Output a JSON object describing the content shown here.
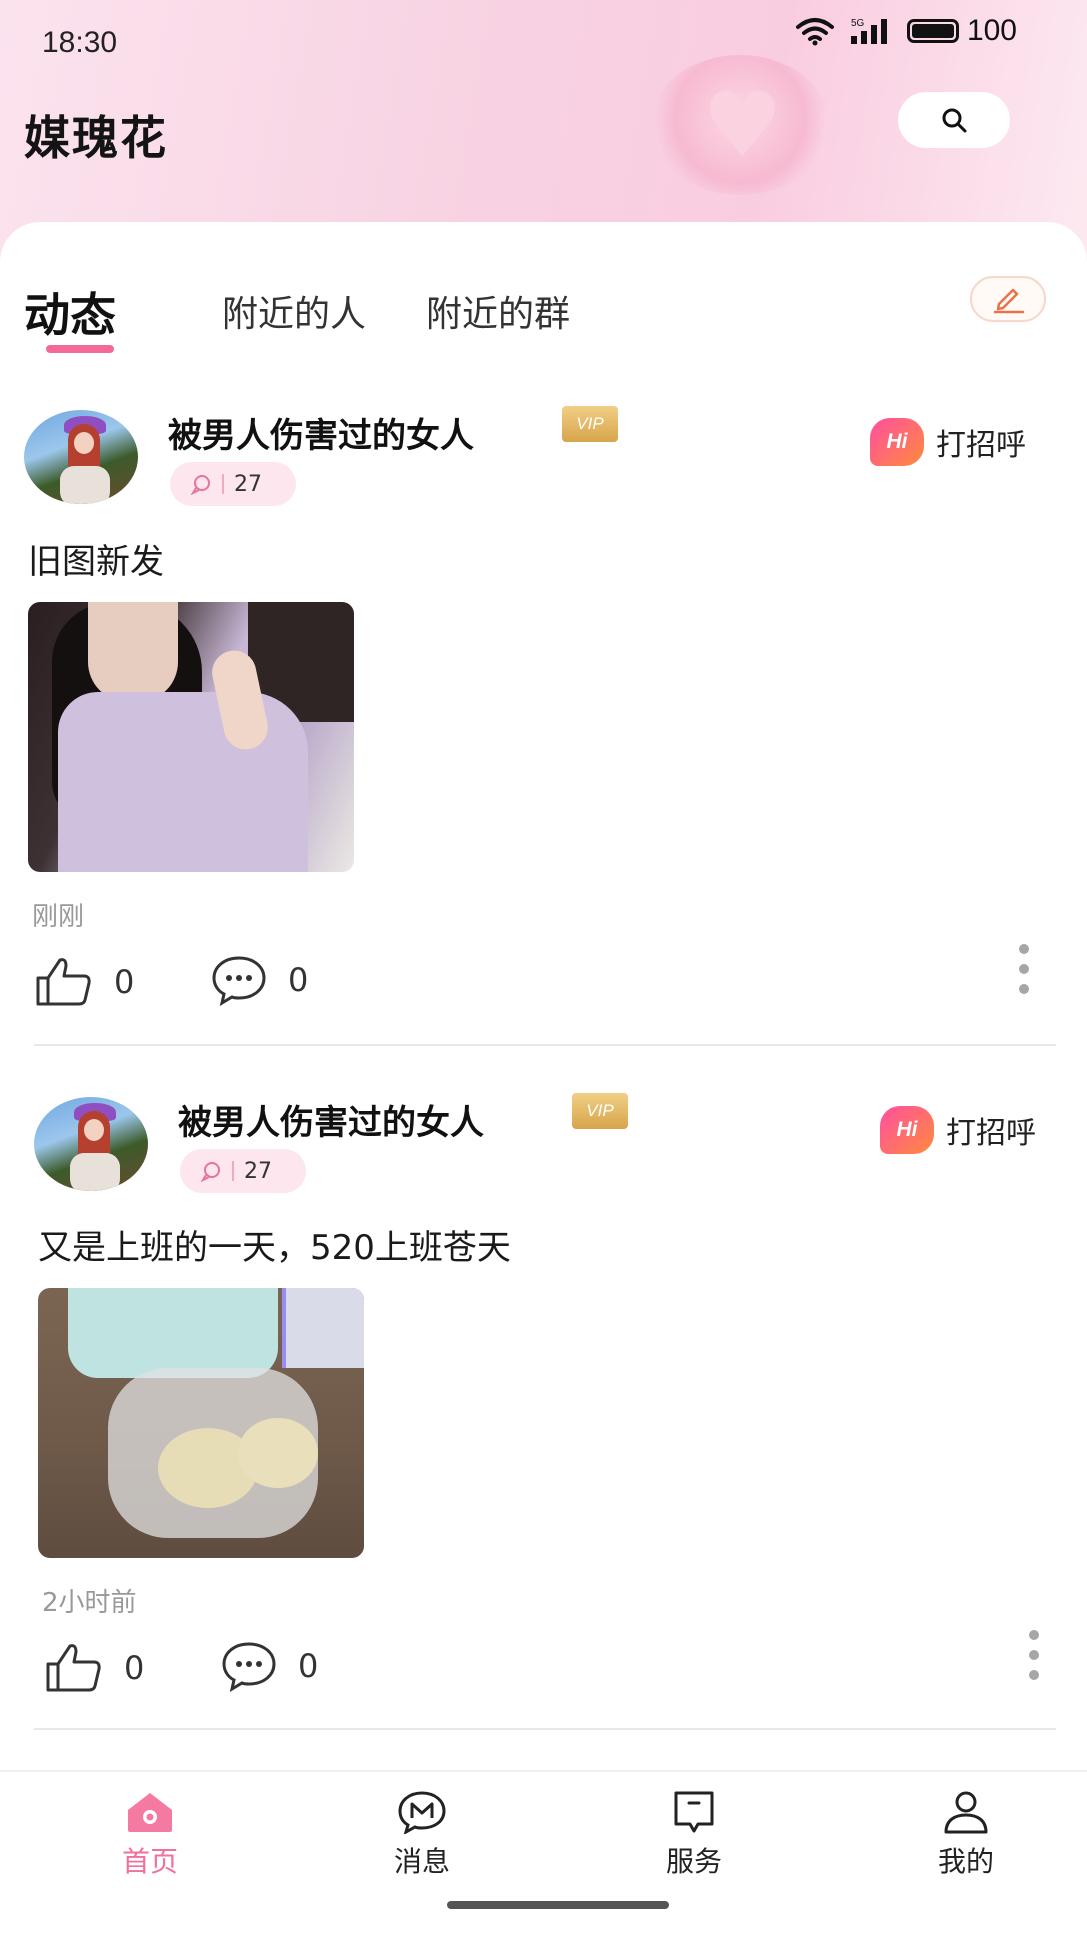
{
  "status_bar": {
    "time": "18:30",
    "battery": "100",
    "network": "5G"
  },
  "header": {
    "app_title": "媒瑰花"
  },
  "tabs": [
    {
      "label": "动态",
      "active": true
    },
    {
      "label": "附近的人",
      "active": false
    },
    {
      "label": "附近的群",
      "active": false
    }
  ],
  "posts": [
    {
      "username": "被男人伤害过的女人",
      "vip": "VIP",
      "comment_count": "27",
      "greet_badge": "Hi",
      "greet_label": "打招呼",
      "text": "旧图新发",
      "time": "刚刚",
      "likes": "0",
      "comments": "0"
    },
    {
      "username": "被男人伤害过的女人",
      "vip": "VIP",
      "comment_count": "27",
      "greet_badge": "Hi",
      "greet_label": "打招呼",
      "text": "又是上班的一天，520上班苍天",
      "time": "2小时前",
      "likes": "0",
      "comments": "0"
    }
  ],
  "bottom_nav": [
    {
      "label": "首页",
      "icon": "home-icon",
      "active": true
    },
    {
      "label": "消息",
      "icon": "message-icon",
      "active": false
    },
    {
      "label": "服务",
      "icon": "service-icon",
      "active": false
    },
    {
      "label": "我的",
      "icon": "profile-icon",
      "active": false
    }
  ],
  "colors": {
    "accent": "#f36a97",
    "chip_bg": "#fde6ee",
    "header_bg": "#f8d2e2",
    "vip_gold": "#d7a44b"
  }
}
